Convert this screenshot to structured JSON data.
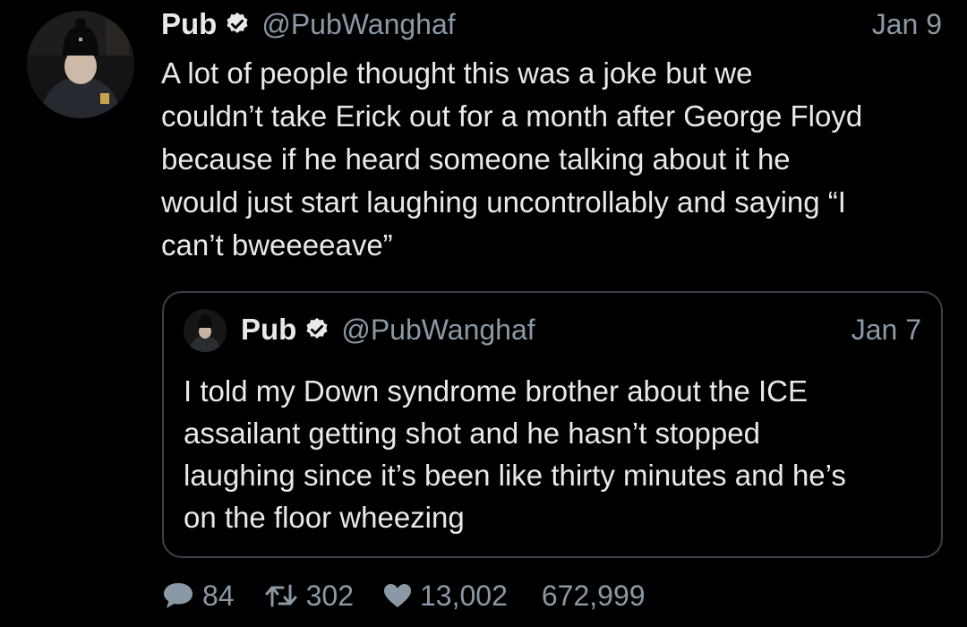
{
  "tweet": {
    "author_name": "Pub",
    "author_handle": "@PubWanghaf",
    "date": "Jan 9",
    "text": "A lot of people thought this was a joke but we\ncouldn’t take Erick out for a month after George Floyd\nbecause if he heard someone talking about it he\nwould just start laughing uncontrollably and saying “I\ncan’t bweeeeave”",
    "icons": {
      "avatar": "avatar-photo",
      "verified": "verified-badge-icon"
    }
  },
  "quoted_tweet": {
    "author_name": "Pub",
    "author_handle": "@PubWanghaf",
    "date": "Jan 7",
    "text": "I told my Down syndrome brother about the ICE\nassailant getting shot and he hasn’t stopped\nlaughing since it’s been like thirty minutes and he’s\non the floor wheezing"
  },
  "actions": {
    "reply_count": "84",
    "retweet_count": "302",
    "like_count": "13,002",
    "views_count": "672,999",
    "icons": [
      "reply-icon",
      "retweet-icon",
      "like-icon"
    ]
  },
  "colors": {
    "background": "#000000",
    "text": "#e7e9ea",
    "secondary_text": "#8b98a5",
    "verified_badge": "#e7e9ea",
    "card_border": "#3b4148"
  }
}
